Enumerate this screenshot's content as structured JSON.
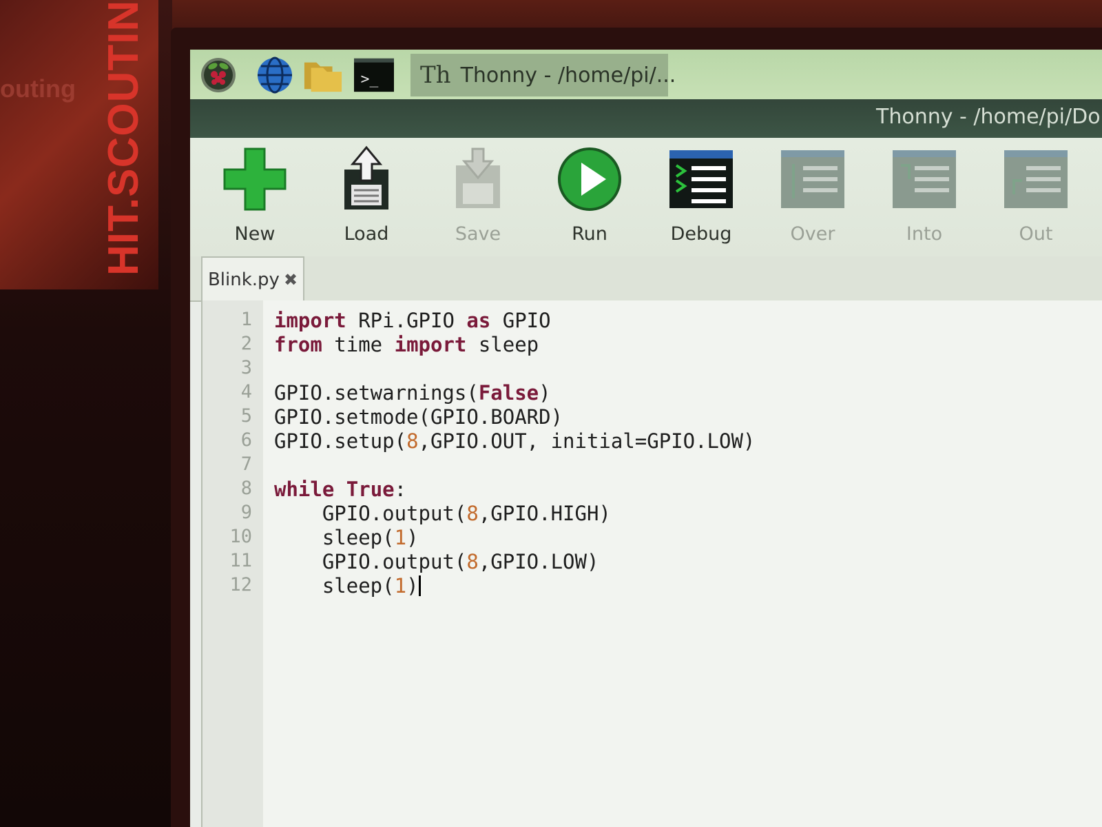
{
  "taskbar": {
    "items": [
      {
        "name": "raspberry-menu-icon"
      },
      {
        "name": "web-browser-icon"
      },
      {
        "name": "file-manager-icon"
      },
      {
        "name": "terminal-icon",
        "glyph": ">_"
      }
    ],
    "active_window": {
      "logo": "Th",
      "title": "Thonny  -  /home/pi/..."
    }
  },
  "window": {
    "title": "Thonny  -  /home/pi/Do"
  },
  "toolbar": {
    "new": "New",
    "load": "Load",
    "save": "Save",
    "run": "Run",
    "debug": "Debug",
    "over": "Over",
    "into": "Into",
    "out": "Out"
  },
  "tab": {
    "label": "Blink.py",
    "close": "✖"
  },
  "colors": {
    "keyword": "#7a1a3a",
    "number": "#c26a2c",
    "run_green": "#2aa43a"
  },
  "editor": {
    "line_numbers": [
      "1",
      "2",
      "3",
      "4",
      "5",
      "6",
      "7",
      "8",
      "9",
      "10",
      "11",
      "12"
    ],
    "lines": [
      [
        {
          "t": "import",
          "c": "kw"
        },
        {
          "t": " RPi.GPIO "
        },
        {
          "t": "as",
          "c": "kw"
        },
        {
          "t": " GPIO"
        }
      ],
      [
        {
          "t": "from",
          "c": "kw"
        },
        {
          "t": " time "
        },
        {
          "t": "import",
          "c": "kw"
        },
        {
          "t": " sleep"
        }
      ],
      [],
      [
        {
          "t": "GPIO.setwarnings("
        },
        {
          "t": "False",
          "c": "kw"
        },
        {
          "t": ")"
        }
      ],
      [
        {
          "t": "GPIO.setmode(GPIO.BOARD)"
        }
      ],
      [
        {
          "t": "GPIO.setup("
        },
        {
          "t": "8",
          "c": "num"
        },
        {
          "t": ",GPIO.OUT, initial=GPIO.LOW)"
        }
      ],
      [],
      [
        {
          "t": "while",
          "c": "kw"
        },
        {
          "t": " "
        },
        {
          "t": "True",
          "c": "kw"
        },
        {
          "t": ":"
        }
      ],
      [
        {
          "t": "    GPIO.output("
        },
        {
          "t": "8",
          "c": "num"
        },
        {
          "t": ",GPIO.HIGH)"
        }
      ],
      [
        {
          "t": "    sleep("
        },
        {
          "t": "1",
          "c": "num"
        },
        {
          "t": ")"
        }
      ],
      [
        {
          "t": "    GPIO.output("
        },
        {
          "t": "8",
          "c": "num"
        },
        {
          "t": ",GPIO.LOW)"
        }
      ],
      [
        {
          "t": "    sleep("
        },
        {
          "t": "1",
          "c": "num"
        },
        {
          "t": ")"
        }
      ]
    ],
    "cursor_line": 12
  },
  "background_poster": {
    "text": "HIT.SCOUTING.I",
    "faded": "outing"
  }
}
